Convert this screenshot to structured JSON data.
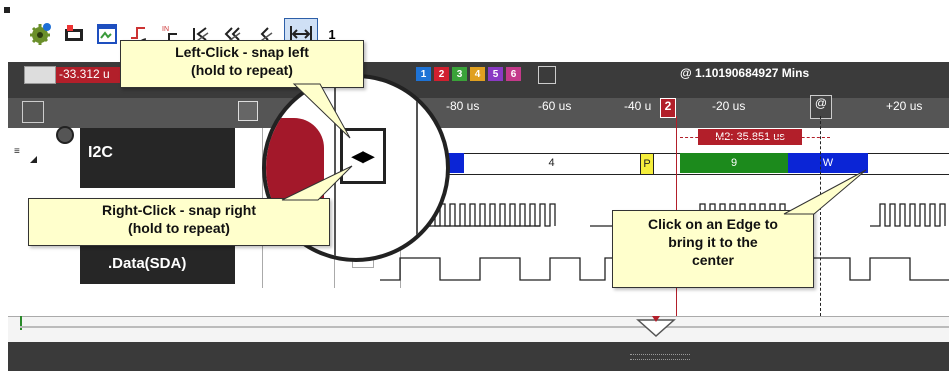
{
  "toolbar": {
    "icons": [
      "gear-icon",
      "capture-icon",
      "window-icon",
      "edge-icon",
      "edge-in-icon",
      "snap-first-icon",
      "snap-back-icon",
      "snap-prev-icon",
      "snap-edge-icon"
    ],
    "page_indicator": "1"
  },
  "header": {
    "cursor_value": "-33.312 u",
    "marker_chips": [
      {
        "label": "1",
        "color": "#1e73d6"
      },
      {
        "label": "2",
        "color": "#d1202f"
      },
      {
        "label": "3",
        "color": "#3aa339"
      },
      {
        "label": "4",
        "color": "#e0a020"
      },
      {
        "label": "5",
        "color": "#8a3ac4"
      },
      {
        "label": "6",
        "color": "#c43a8a"
      }
    ],
    "timestamp": "@ 1.10190684927 Mins"
  },
  "ruler": {
    "ticks": [
      "-80 us",
      "-60 us",
      "-40 u",
      "-20 us",
      "+20 us"
    ],
    "marker_2_label": "2",
    "at_label": "@"
  },
  "channels": [
    {
      "name": "I2C",
      "subtitle": ""
    },
    {
      "name": ".Data(SDA)",
      "subtitle": ""
    }
  ],
  "measurement": {
    "label": "M2: 35.851 us"
  },
  "packets": {
    "p1_value": "4",
    "p_label": "P",
    "p2_value": "9",
    "p3_value": "W"
  },
  "callouts": {
    "left_click": [
      "Left-Click - snap left",
      "(hold to repeat)"
    ],
    "right_click": [
      "Right-Click - snap right",
      "(hold to repeat)"
    ],
    "edge_click": [
      "Click on an Edge to",
      "bring it to the",
      "center"
    ]
  },
  "colors": {
    "accent_red": "#b21f2a",
    "packet_green": "#1c8a1c",
    "packet_blue": "#0b25d6",
    "callout_bg": "#ffffcc"
  }
}
